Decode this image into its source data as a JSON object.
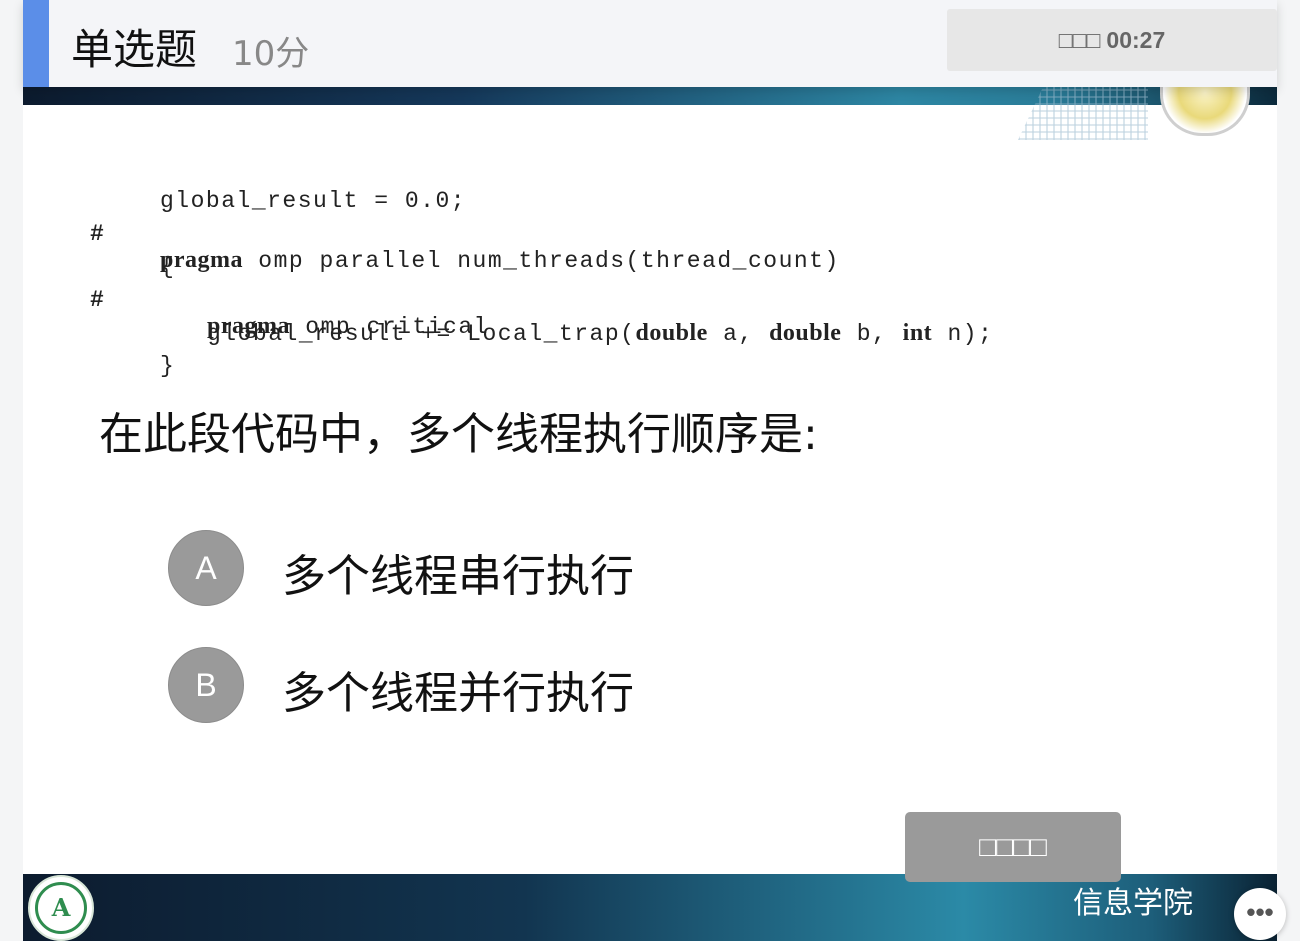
{
  "header": {
    "title": "单选题",
    "score": "10分"
  },
  "timer": {
    "label": "□□□",
    "time": "00:27"
  },
  "code": {
    "hash1": "#",
    "hash2": "#",
    "l1": "global_result = 0.0;",
    "l2_kw": "pragma",
    "l2_rest": " omp parallel num_threads(thread_count)",
    "l3": "{",
    "l4_kw": "pragma",
    "l4_rest": " omp critical",
    "l5_a": "global_result += Local_trap(",
    "l5_kw1": "double",
    "l5_b": " a, ",
    "l5_kw2": "double",
    "l5_c": " b, ",
    "l5_kw3": "int",
    "l5_d": " n);",
    "l6": "}"
  },
  "question": "在此段代码中，多个线程执行顺序是:",
  "options": [
    {
      "letter": "A",
      "text": "多个线程串行执行"
    },
    {
      "letter": "B",
      "text": "多个线程并行执行"
    }
  ],
  "submit_label": "□□□□",
  "footer": {
    "school": "信息学院",
    "logo_mark": "A"
  },
  "more_label": "•••",
  "colors": {
    "accent": "#5b8ee8",
    "option_bubble": "#9a9a9a",
    "submit": "#9a9a9a",
    "band_dark": "#0c1b2e",
    "band_teal": "#2d86a3"
  }
}
